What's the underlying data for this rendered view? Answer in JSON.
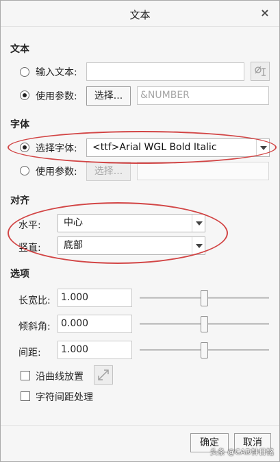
{
  "window": {
    "title": "文本",
    "close_glyph": "×"
  },
  "text_section": {
    "heading": "文本",
    "enter_text_label": "输入文本:",
    "enter_text_value": "",
    "use_param_label": "使用参数:",
    "select_button": "选择...",
    "param_placeholder": "&NUMBER",
    "symbol_icon": "special-symbol-icon"
  },
  "font_section": {
    "heading": "字体",
    "select_font_label": "选择字体:",
    "font_value": "<ttf>Arial WGL Bold Italic",
    "use_param_label": "使用参数:",
    "select_button": "选择...",
    "param_value": ""
  },
  "align_section": {
    "heading": "对齐",
    "horizontal_label": "水平:",
    "horizontal_value": "中心",
    "vertical_label": "竖直:",
    "vertical_value": "底部"
  },
  "options_section": {
    "heading": "选项",
    "aspect_label": "长宽比:",
    "aspect_value": "1.000",
    "slant_label": "倾斜角:",
    "slant_value": "0.000",
    "spacing_label": "间距:",
    "spacing_value": "1.000",
    "along_curve_label": "沿曲线放置",
    "kerning_label": "字符间距处理",
    "flip_icon": "flip-direction-icon"
  },
  "footer": {
    "ok_button": "确定",
    "cancel_button": "取消",
    "watermark": "头条 @CAD钟日铭"
  },
  "colors": {
    "annotation": "#d24545"
  }
}
